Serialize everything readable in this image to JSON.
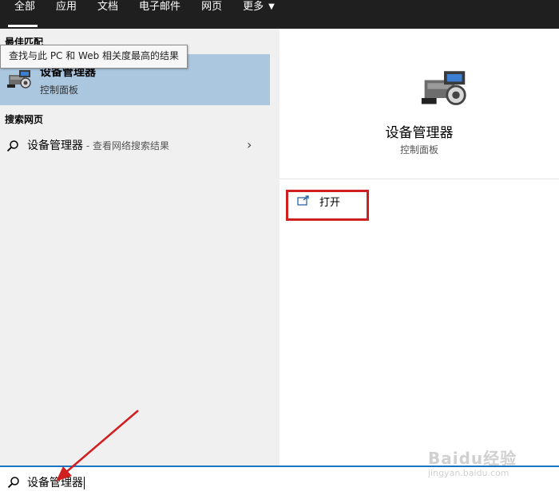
{
  "tabs": [
    {
      "label": "全部",
      "active": true
    },
    {
      "label": "应用"
    },
    {
      "label": "文档"
    },
    {
      "label": "电子邮件"
    },
    {
      "label": "网页"
    },
    {
      "label": "更多"
    }
  ],
  "left": {
    "best_match_header": "最佳匹配",
    "tooltip": "查找与此 PC 和 Web 相关度最高的结果",
    "best_match": {
      "title": "设备管理器",
      "subtitle": "控制面板",
      "icon": "device-manager-icon"
    },
    "web_header": "搜索网页",
    "web_result": {
      "text": "设备管理器",
      "suffix": " - 查看网络搜索结果"
    }
  },
  "right": {
    "title": "设备管理器",
    "subtitle": "控制面板",
    "actions": [
      {
        "label": "打开",
        "icon": "open-icon"
      }
    ]
  },
  "search": {
    "query": "设备管理器"
  },
  "watermark": {
    "main": "Baidu经验",
    "sub": "jingyan.baidu.com"
  },
  "colors": {
    "topbar": "#1f1f1f",
    "selected": "#aac7df",
    "left_bg": "#f0f0f0",
    "accent": "#1a74c4",
    "annotation": "#d01f1f"
  }
}
